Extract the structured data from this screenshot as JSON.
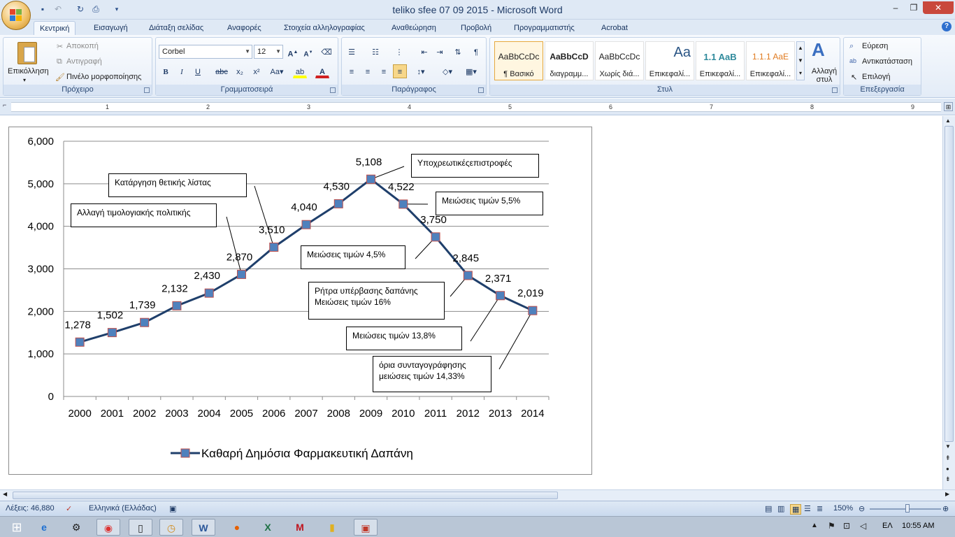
{
  "window": {
    "title": "teliko sfee 07 09 2015 - Microsoft Word",
    "minimize": "‒",
    "restore": "❐",
    "close": "✕"
  },
  "quick_access": [
    "save-icon",
    "undo-icon",
    "redo-icon",
    "print-icon"
  ],
  "tabs": [
    {
      "label": "Κεντρική",
      "active": true
    },
    {
      "label": "Εισαγωγή"
    },
    {
      "label": "Διάταξη σελίδας"
    },
    {
      "label": "Αναφορές"
    },
    {
      "label": "Στοιχεία αλληλογραφίας"
    },
    {
      "label": "Αναθεώρηση"
    },
    {
      "label": "Προβολή"
    },
    {
      "label": "Προγραμματιστής"
    },
    {
      "label": "Acrobat"
    }
  ],
  "ribbon": {
    "clipboard": {
      "group_label": "Πρόχειρο",
      "paste": "Επικόλληση",
      "cut": "Αποκοπή",
      "copy": "Αντιγραφή",
      "format_painter": "Πινέλο μορφοποίησης"
    },
    "font": {
      "group_label": "Γραμματοσειρά",
      "font_name": "Corbel",
      "font_size": "12"
    },
    "paragraph": {
      "group_label": "Παράγραφος"
    },
    "styles": {
      "group_label": "Στυλ",
      "items": [
        {
          "preview": "AaBbCcDc",
          "name": "¶ Βασικό"
        },
        {
          "preview": "AaBbCcD",
          "name": "διαγραμμ..."
        },
        {
          "preview": "AaBbCcDc",
          "name": "Χωρίς διά..."
        },
        {
          "preview": "Aa",
          "name": "Επικεφαλί..."
        },
        {
          "preview": "1.1  AaB",
          "name": "Επικεφαλί..."
        },
        {
          "preview": "1.1.1  AaE",
          "name": "Επικεφαλί..."
        }
      ],
      "change_styles": "Αλλαγή στυλ"
    },
    "editing": {
      "group_label": "Επεξεργασία",
      "find": "Εύρεση",
      "replace": "Αντικατάσταση",
      "select": "Επιλογή"
    }
  },
  "ruler_numbers": [
    "1",
    "2",
    "3",
    "4",
    "5",
    "6",
    "7",
    "8",
    "9"
  ],
  "chart_data": {
    "type": "line",
    "categories": [
      "2000",
      "2001",
      "2002",
      "2003",
      "2004",
      "2005",
      "2006",
      "2007",
      "2008",
      "2009",
      "2010",
      "2011",
      "2012",
      "2013",
      "2014"
    ],
    "series": [
      {
        "name": "Καθαρή Δημόσια Φαρμακευτική Δαπάνη",
        "values": [
          1278,
          1502,
          1739,
          2132,
          2430,
          2870,
          3510,
          4040,
          4530,
          5108,
          4522,
          3750,
          2845,
          2371,
          2019
        ],
        "labels": [
          "1,278",
          "1,502",
          "1,739",
          "2,132",
          "2,430",
          "2,870",
          "3,510",
          "4,040",
          "4,530",
          "5,108",
          "4,522",
          "3,750",
          "2,845",
          "2,371",
          "2,019"
        ],
        "line_color": "#1f3f6b",
        "marker_color": "#4f81bd",
        "marker_edge": "#c0504d"
      }
    ],
    "y_ticks": [
      "0",
      "1,000",
      "2,000",
      "3,000",
      "4,000",
      "5,000",
      "6,000"
    ],
    "ylim": [
      0,
      6000
    ],
    "grid": true,
    "legend": "bottom",
    "annotations": [
      {
        "text": "Κατάργηση θετικής λίστας"
      },
      {
        "text": "Αλλαγή τιμολογιακής πολιτικής"
      },
      {
        "text": "Υποχρεωτικέςεπιστροφές"
      },
      {
        "text": "Μειώσεις τιμών 5,5%"
      },
      {
        "text": "Μειώσεις τιμών 4,5%"
      },
      {
        "text": "Ρήτρα υπέρβασης δαπάνης\nΜειώσεις τιμών 16%"
      },
      {
        "text": "Μειώσεις τιμών 13,8%"
      },
      {
        "text": "όρια συνταγογράφησης\nμειώσεις τιμών 14,33%"
      }
    ]
  },
  "statusbar": {
    "words": "Λέξεις: 46,880",
    "language": "Ελληνικά (Ελλάδας)",
    "zoom": "150%"
  },
  "taskbar": {
    "icons": [
      "ie-icon",
      "control-panel-icon",
      "chrome-icon",
      "notepad-icon",
      "clock-app-icon",
      "word-icon",
      "firefox-icon",
      "excel-icon",
      "app-m-icon",
      "folder-icon",
      "screenshot-icon"
    ],
    "language": "ΕΛ",
    "time": "10:55 AM"
  }
}
